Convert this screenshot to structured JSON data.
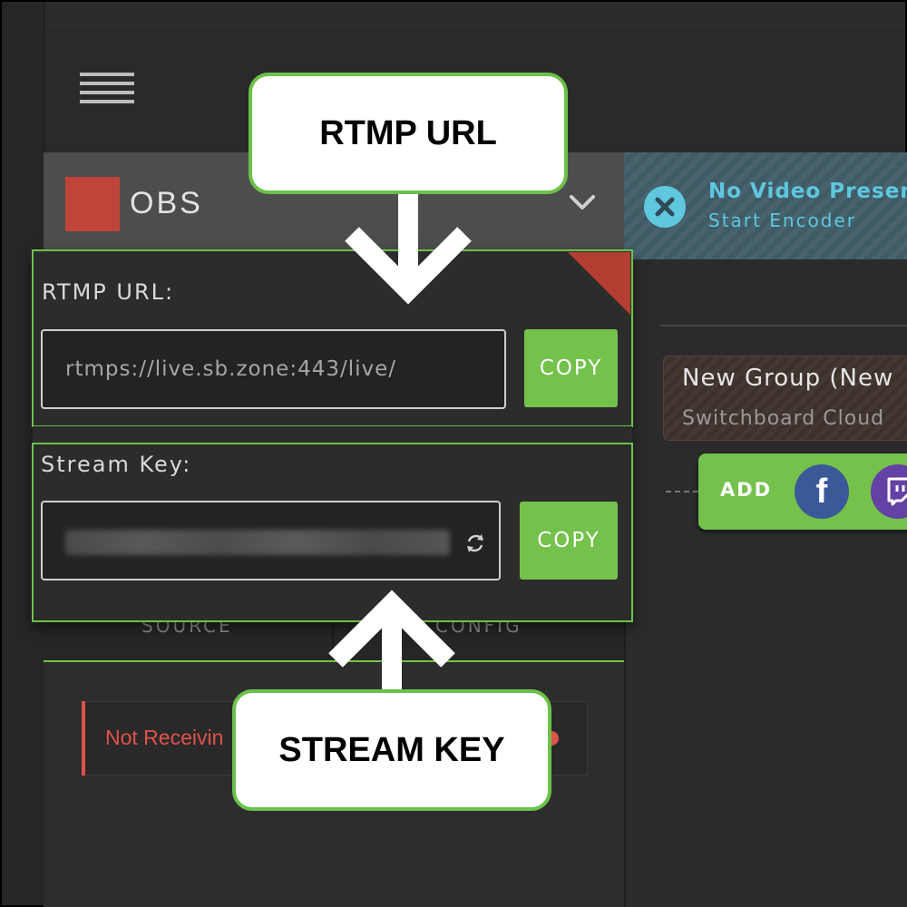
{
  "app": {
    "source_name": "OBS",
    "source_color": "#c1443a"
  },
  "status_banner": {
    "title": "No Video Presen",
    "subtitle": "Start Encoder",
    "color": "#5fc7de"
  },
  "popup": {
    "rtmp_label": "RTMP URL:",
    "rtmp_value": "rtmps://live.sb.zone:443/live/",
    "rtmp_copy": "COPY",
    "key_label": "Stream Key:",
    "key_copy": "COPY",
    "accent": "#74c14c"
  },
  "tabs": {
    "source": "SOURCE",
    "config": "CONFIG"
  },
  "status_row": {
    "text": "Not Receivin",
    "color": "#e0524a"
  },
  "group": {
    "name": "New Group (New",
    "destination": "Switchboard Cloud"
  },
  "add_bar": {
    "label": "ADD",
    "facebook_glyph": "f"
  },
  "callouts": {
    "top": "RTMP URL",
    "bottom": "STREAM KEY"
  },
  "icons": [
    "hamburger-menu-icon",
    "chevron-down-icon",
    "close-circle-icon",
    "refresh-icon",
    "facebook-icon",
    "twitch-icon",
    "arrow-down-icon",
    "arrow-up-icon"
  ]
}
